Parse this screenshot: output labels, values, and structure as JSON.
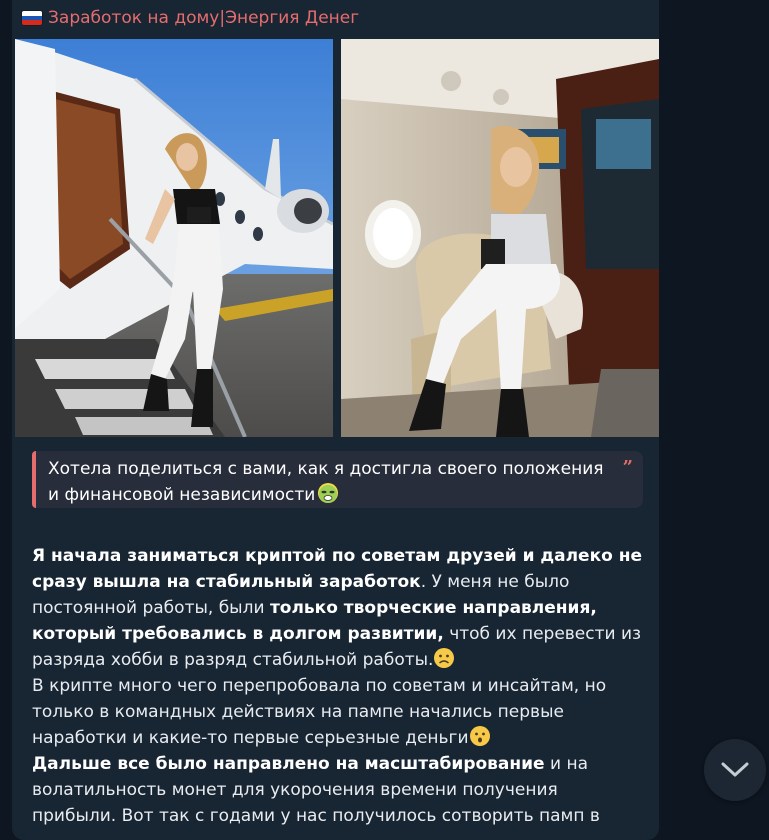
{
  "message": {
    "sender": "Заработок на дому|Энергия Денег",
    "quote": {
      "text": "Хотела поделиться с вами, как я достигла своего положения и финансовой независимости"
    },
    "body": {
      "p1_bold": "Я начала заниматься криптой по советам друзей и далеко не сразу вышла на стабильный заработок",
      "p1_a": ". У меня не было постоянной работы, были ",
      "p1_bold2": "только творческие направления, который требовались в долгом развитии,",
      "p1_b": " чтоб их перевести из разряда хобби в разряд стабильной работы.",
      "p2": "В крипте много чего перепробовала по советам и инсайтам, но только в командных действиях на пампе начались первые наработки и какие-то первые серьезные деньги",
      "p3_bold": "Дальше все было направлено на масштабирование",
      "p3_a": " и на волатильность монет для укорочения времени получения прибыли. Вот так с годами у нас получилось сотворить памп в"
    }
  },
  "icons": {
    "flag": "russia-flag-icon",
    "quote": "quote-mark-icon",
    "emoji_nauseated": "nauseated-face-emoji",
    "emoji_frown": "frowning-face-emoji",
    "emoji_hushed": "hushed-face-emoji",
    "scroll": "chevron-down-icon"
  },
  "colors": {
    "accent": "#e56d6d",
    "bubble": "#182533",
    "background": "#0e1621"
  }
}
